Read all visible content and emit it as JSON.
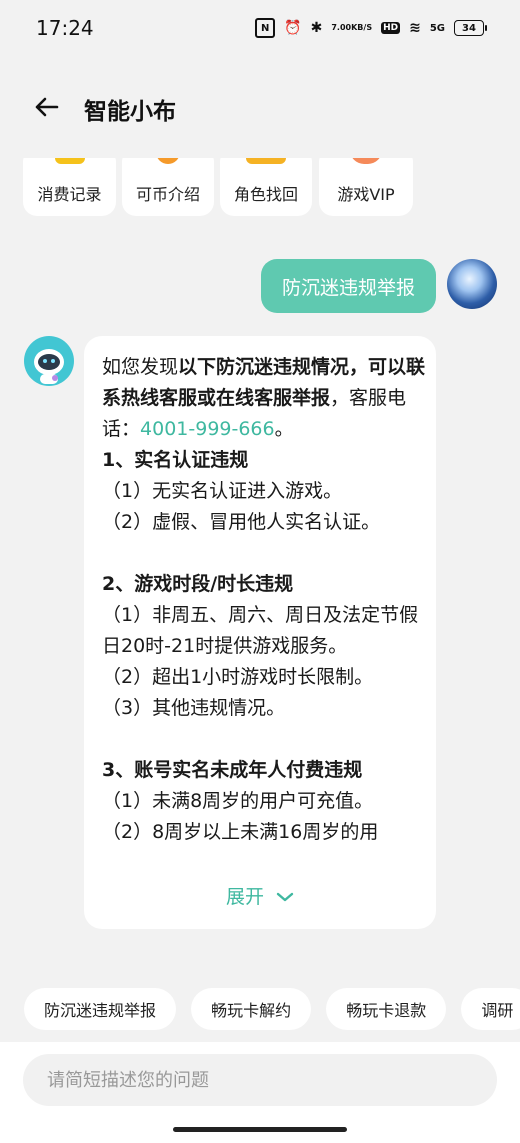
{
  "status_bar": {
    "time": "17:24",
    "nfc": "N",
    "alarm": "⏰",
    "bluetooth": "✱",
    "net_speed_value": "7.00",
    "net_speed_unit": "KB/S",
    "hd": "HD",
    "wifi": "≋",
    "signal": "5G",
    "battery": "34"
  },
  "header": {
    "title": "智能小布"
  },
  "shortcuts": [
    {
      "label": "消费记录",
      "icon": "star-icon",
      "color": "#f5c21b"
    },
    {
      "label": "可币介绍",
      "icon": "coin-icon",
      "color": "#f59a2a"
    },
    {
      "label": "角色找回",
      "icon": "card-icon",
      "color": "#f5b224"
    },
    {
      "label": "游戏VIP",
      "icon": "vip-icon",
      "color": "#f58a5a"
    }
  ],
  "user_message": "防沉迷违规举报",
  "bot_message": {
    "intro_1": "如您发现",
    "intro_bold": "以下防沉迷违规情况，可以联系热线客服或在线客服举报",
    "intro_2": "，客服电话：",
    "phone": "4001-999-666",
    "intro_end": "。",
    "section_1_title": "1、实名认证违规",
    "section_1_item_1": "（1）无实名认证进入游戏。",
    "section_1_item_2": "（2）虚假、冒用他人实名认证。",
    "section_2_title": "2、游戏时段/时长违规",
    "section_2_item_1": "（1）非周五、周六、周日及法定节假日20时-21时提供游戏服务。",
    "section_2_item_2": "（2）超出1小时游戏时长限制。",
    "section_2_item_3": "（3）其他违规情况。",
    "section_3_title": "3、账号实名未成年人付费违规",
    "section_3_item_1": "（1）未满8周岁的用户可充值。",
    "section_3_item_2": "（2）8周岁以上未满16周岁的用",
    "expand_label": "展开"
  },
  "chips": [
    "防沉迷违规举报",
    "畅玩卡解约",
    "畅玩卡退款",
    "调研"
  ],
  "input": {
    "placeholder": "请简短描述您的问题"
  },
  "colors": {
    "accent": "#5fc9b0",
    "link": "#3fb8a0",
    "background": "#f2f2f2"
  }
}
